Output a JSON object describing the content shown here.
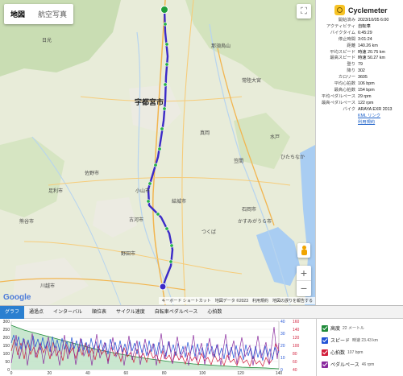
{
  "map": {
    "type_buttons": [
      "地図",
      "航空写真"
    ],
    "selected_type": "地図",
    "logo": "Google",
    "attribution": "キーボード ショートカット　地図データ ©2023　利用規約　地図の誤りを報告する",
    "labels": {
      "nikko": "日光",
      "utsunomiya": "宇都宮市",
      "oyama": "小山市",
      "kawagoe": "川越市",
      "koga": "古河市",
      "yuki": "結城市",
      "mito": "水戸",
      "kasama": "笠間",
      "kasumigaura": "かすみがうら市",
      "tsukuba": "つくば",
      "noda": "野田市",
      "sano": "佐野市",
      "ashikaga": "足利市",
      "hitachiomiya": "常陸大宮",
      "nasukarasuyama": "那須烏山",
      "moka": "真岡",
      "ishioka": "石岡市",
      "kumagaya": "熊谷市",
      "hitachinaka": "ひたちなか"
    }
  },
  "info": {
    "app_name": "Cyclemeter",
    "rows": [
      {
        "k": "開始済み",
        "v": "2023/10/05 6:00"
      },
      {
        "k": "アクティビティ",
        "v": "自転車"
      },
      {
        "k": "バイクタイム",
        "v": "6:45:29"
      },
      {
        "k": "停止時間",
        "v": "3:01:24"
      },
      {
        "k": "距離",
        "v": "140.26 km"
      },
      {
        "k": "平均スピード",
        "v": "時速 20.75 km"
      },
      {
        "k": "最高スピード",
        "v": "時速 50.27 km"
      },
      {
        "k": "登り",
        "v": "79"
      },
      {
        "k": "降り",
        "v": "302"
      },
      {
        "k": "カロリー",
        "v": "3605"
      },
      {
        "k": "平均心拍数",
        "v": "106 bpm"
      },
      {
        "k": "最高心拍数",
        "v": "154 bpm"
      },
      {
        "k": "平均ペダルペース",
        "v": "29 rpm"
      },
      {
        "k": "最高ペダルペース",
        "v": "122 rpm"
      },
      {
        "k": "バイク",
        "v": "ARAYA EXR 2013"
      }
    ],
    "kml_link": "KML リンク",
    "terms_link": "利用規約"
  },
  "tabs": [
    "グラフ",
    "通過点",
    "インターバル",
    "順位表",
    "サイクル速度",
    "自転車ペダルペース",
    "心拍数"
  ],
  "selected_tab": "グラフ",
  "graph": {
    "left_ticks": [
      "300",
      "250",
      "200",
      "150",
      "100",
      "50",
      "0"
    ],
    "x_ticks": [
      "0",
      "20",
      "40",
      "60",
      "80",
      "100",
      "120",
      "140"
    ],
    "right_ticks_a": [
      "40",
      "30",
      "20",
      "10",
      "0"
    ],
    "right_ticks_b": [
      "160",
      "140",
      "120",
      "100",
      "80",
      "60",
      "40"
    ]
  },
  "legend": [
    {
      "name": "高度",
      "value": "22 メートル",
      "color": "#1f8a3a"
    },
    {
      "name": "スピード",
      "value": "時速 23.43 km",
      "color": "#2254d6"
    },
    {
      "name": "心拍数",
      "value": "107 bpm",
      "color": "#d21f3c"
    },
    {
      "name": "ペダルペース",
      "value": "46 rpm",
      "color": "#8a2b9e"
    }
  ]
}
